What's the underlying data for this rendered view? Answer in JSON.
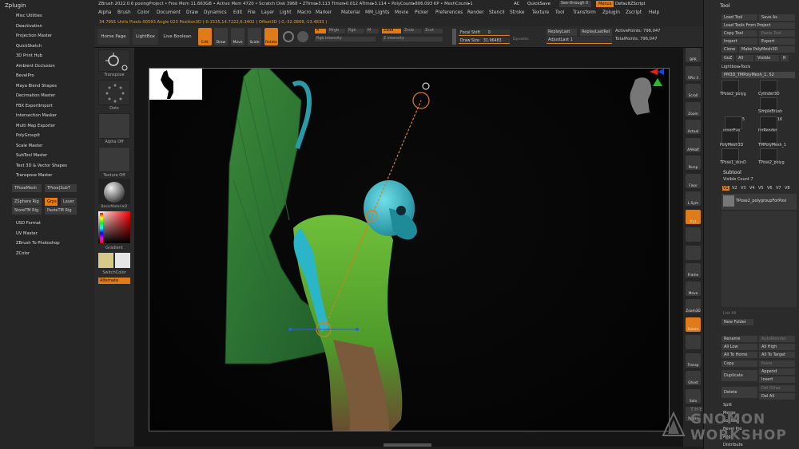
{
  "left_panel": {
    "title": "Zplugin",
    "items": [
      "Misc Utilities",
      "Deactivation",
      "Projection Master",
      "QuickSketch",
      "3D Print Hub",
      "Ambient Occlusion",
      "BevelPro",
      "Maya Blend Shapes",
      "Decimation Master",
      "FBX ExportImport",
      "Intersection Masker",
      "Multi Map Exporter",
      "PolyGroupIt",
      "Scale Master",
      "SubTool Master",
      "Text 3D & Vector Shapes",
      "Transpose Master"
    ],
    "buttons": [
      "TPoseMesh",
      "TPose|SubT",
      "ZSphere Rig",
      "Grps",
      "Layer",
      "StoreTM Rig",
      "PasteTM Rig"
    ],
    "items2": [
      "USD Format",
      "UV Master",
      "ZBrush To Photoshop",
      "ZColor"
    ]
  },
  "titlebar": "ZBrush 2022.0.6 posingProject  • Free Mem 11.663GB • Active Mem 4720 • Scratch Disk 3968 • ZTime▸3.113 Timer▸0.012 ATime▸3.114 • PolyCount▸806.093 KP • MeshCount▸1",
  "titlebar_right": {
    "ac": "AC",
    "quicksave": "QuickSave",
    "seethrough": "See-through  0",
    "menus": "Menus",
    "script": "DefaultZScript"
  },
  "menu": [
    "Alpha",
    "Brush",
    "Color",
    "Document",
    "Draw",
    "Dynamics",
    "Edit",
    "File",
    "Layer",
    "Light",
    "Macro",
    "Marker",
    "Material",
    "MM_Lights",
    "Movie",
    "Picker",
    "Preferences",
    "Render",
    "Stencil",
    "Stroke",
    "Texture",
    "Tool",
    "Transform",
    "Zplugin",
    "Zscript",
    "Help"
  ],
  "infobar": "34.7991 Units   Pixels 00593 Angle 023 Position3D (-0.1535,14.7222,6.3402 )  Offset3D (-0,-32.0808,-13.4833 )",
  "toolbar": {
    "home": "Home Page",
    "lightbox": "LightBox",
    "boolean": "Live Boolean",
    "edit": "Edit",
    "draw": "Draw",
    "move": "Move",
    "scale": "Scale",
    "rotate": "Rotate",
    "a": "A",
    "mrgb": "Mrgb",
    "rgb": "Rgb",
    "m": "M",
    "zadd": "Zadd",
    "zsub": "Zsub",
    "zcut": "Zcut",
    "rgb_intensity": "Rgb Intensity",
    "z_intensity": "Z Intensity",
    "focal_shift": "Focal Shift",
    "focal_value": "0",
    "draw_size": "Draw Size",
    "draw_value": "31.96483",
    "dynamic": "Dynamic",
    "replay_last": "ReplayLast",
    "replay_last_rel": "ReplayLastRel",
    "adjust_last": "AdjustLast",
    "adjust_value": "1",
    "active_points": "ActivePoints: 796,047",
    "total_points": "TotalPoints: 796,047"
  },
  "shelf": {
    "transpose": "Transpose",
    "dots": "Dots",
    "alpha": "Alpha Off",
    "texture": "Texture Off",
    "material": "BasicMaterial2",
    "gradient": "Gradient",
    "switch": "SwitchColor",
    "alternate": "Alternate"
  },
  "right_strip": [
    "BPR",
    "SPix 3",
    "Scroll",
    "Zoom",
    "Actual",
    "AAHalf",
    "Persp",
    "Floor",
    "L.Sym",
    "Xyz",
    "",
    "",
    "Frame",
    "Move",
    "Zoom3D",
    "Rotate",
    "",
    "Transp",
    "Ghost",
    "Solo",
    "Xpose"
  ],
  "tool_panel": {
    "title": "Tool",
    "load_tool": "Load Tool",
    "save_as": "Save As",
    "load_project": "Load Tools From Project",
    "copy_tool": "Copy Tool",
    "paste_tool": "Paste Tool",
    "import": "Import",
    "export": "Export",
    "clone": "Clone",
    "make_polymesh": "Make PolyMesh3D",
    "goz": "GoZ",
    "all": "All",
    "visible": "Visible",
    "r": "R",
    "lightbox_tools": "Lightbox▸Tools",
    "current_tool": "PM3D_TMPolyMesh_1. 52",
    "thumbs": [
      {
        "label": "TPose2_polyg",
        "num": ""
      },
      {
        "label": "Cylinder3D",
        "num": ""
      },
      {
        "label": "SimpleBrush",
        "num": ""
      },
      {
        "label": "innerEye",
        "num": "5"
      },
      {
        "label": "forRender",
        "num": "16"
      },
      {
        "label": "PolyMesh3D",
        "num": ""
      },
      {
        "label": "TMPolyMesh_1",
        "num": ""
      },
      {
        "label": "TPose1_skinD",
        "num": ""
      },
      {
        "label": "TPose2_polyg",
        "num": ""
      }
    ],
    "subtool": "Subtool",
    "visible_count": "Visible Count 7",
    "v_labels": [
      "V1",
      "V2",
      "V3",
      "V4",
      "V5",
      "V6",
      "V7",
      "V8"
    ],
    "subtool_item": "TPose2_polygroupForPosi",
    "list_all": "List All",
    "new_folder": "New Folder",
    "rename": "Rename",
    "auto_reorder": "AutoReorder",
    "all_low": "All Low",
    "all_high": "All High",
    "all_to_home": "All To Home",
    "all_to_target": "All To Target",
    "copy": "Copy",
    "paste": "Paste",
    "duplicate": "Duplicate",
    "append": "Append",
    "insert": "Insert",
    "delete": "Delete",
    "del_other": "Del Other",
    "del_all": "Del All",
    "split": "Split",
    "merge": "Merge",
    "boolean": "Boolean",
    "bevel_pro": "Bevel Pro",
    "align": "Align",
    "distribute": "Distribute"
  },
  "watermark": {
    "line1": "THE",
    "line2": "GNOMON",
    "line3": "WORKSHOP"
  },
  "colors": {
    "accent": "#e07b1a",
    "bg": "#262626",
    "canvas": "#050505",
    "creature_green": "#4a9a2a",
    "skull_cyan": "#35b9c9"
  }
}
